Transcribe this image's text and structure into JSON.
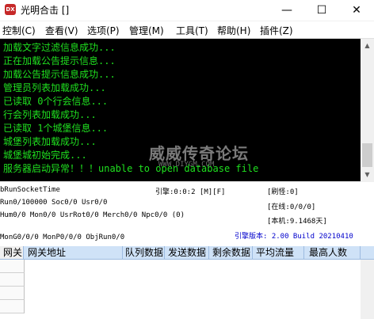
{
  "window": {
    "title": "光明合击 []",
    "app_icon_text": "DX",
    "minimize_symbol": "—",
    "maximize_symbol": "☐",
    "close_symbol": "✕"
  },
  "menu": {
    "items": [
      "控制(C)",
      "查看(V)",
      "选项(P)",
      "管理(M)",
      "工具(T)",
      "帮助(H)",
      "插件(Z)"
    ]
  },
  "console": {
    "lines": [
      "加载文字过滤信息成功...",
      "正在加载公告提示信息...",
      "加载公告提示信息成功...",
      "管理员列表加载成功...",
      "已读取 0个行会信息...",
      "行会列表加载成功...",
      "已读取 1个城堡信息...",
      "城堡列表加载成功...",
      "城堡城初始完成...",
      "服务器启动异常！！！unable to open database file"
    ],
    "text_color": "#1fe01f",
    "background": "#000000"
  },
  "watermark": {
    "text": "威威传奇论坛",
    "url": "WWW.DIYGM.COM"
  },
  "info": {
    "run_socket_time": "bRunSocketTime",
    "engine_time": "引擎:0:0:2 [M][F]",
    "refresh": "[刷怪:0]",
    "run_line": "Run0/100000 Soc0/0 Usr0/0",
    "online": "[在线:0/0/0]",
    "hum_line": "Hum0/0 Mon0/0 UsrRot0/0 Merch0/0 Npc0/0 (0)",
    "machine": "[本机:9.1468天]",
    "mon_line": "MonG0/0/0 MonP0/0/0 ObjRun0/0",
    "engine_version": "引擎版本: 2.00 Build 20210410",
    "version_color": "#0000cc"
  },
  "grid": {
    "columns": [
      "网关",
      "网关地址",
      "队列数据",
      "发送数据",
      "剩余数据",
      "平均流量",
      "最高人数"
    ],
    "header_color": "#cfe2f7"
  }
}
